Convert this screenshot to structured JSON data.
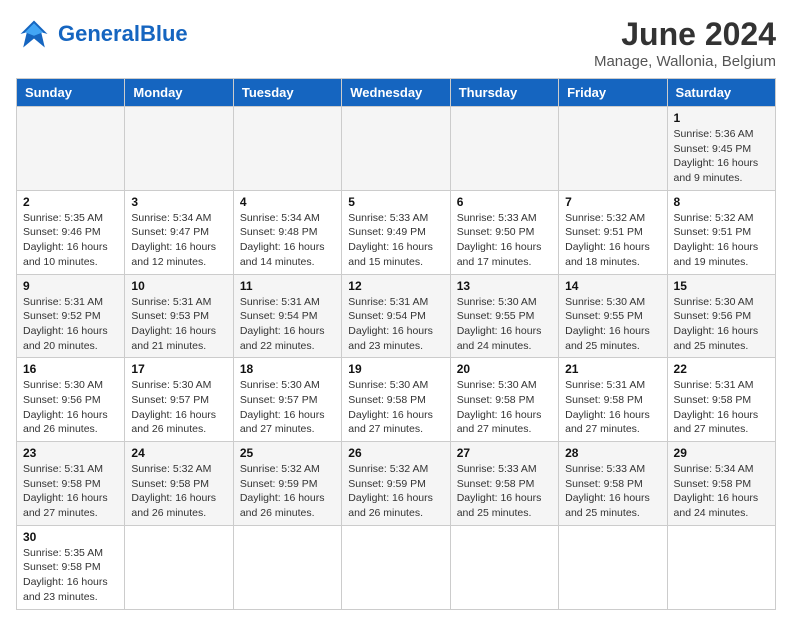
{
  "logo": {
    "text_general": "General",
    "text_blue": "Blue"
  },
  "title": "June 2024",
  "subtitle": "Manage, Wallonia, Belgium",
  "weekdays": [
    "Sunday",
    "Monday",
    "Tuesday",
    "Wednesday",
    "Thursday",
    "Friday",
    "Saturday"
  ],
  "weeks": [
    [
      {
        "day": "",
        "info": ""
      },
      {
        "day": "",
        "info": ""
      },
      {
        "day": "",
        "info": ""
      },
      {
        "day": "",
        "info": ""
      },
      {
        "day": "",
        "info": ""
      },
      {
        "day": "",
        "info": ""
      },
      {
        "day": "1",
        "info": "Sunrise: 5:36 AM\nSunset: 9:45 PM\nDaylight: 16 hours\nand 9 minutes."
      }
    ],
    [
      {
        "day": "2",
        "info": "Sunrise: 5:35 AM\nSunset: 9:46 PM\nDaylight: 16 hours\nand 10 minutes."
      },
      {
        "day": "3",
        "info": "Sunrise: 5:34 AM\nSunset: 9:47 PM\nDaylight: 16 hours\nand 12 minutes."
      },
      {
        "day": "4",
        "info": "Sunrise: 5:34 AM\nSunset: 9:48 PM\nDaylight: 16 hours\nand 14 minutes."
      },
      {
        "day": "5",
        "info": "Sunrise: 5:33 AM\nSunset: 9:49 PM\nDaylight: 16 hours\nand 15 minutes."
      },
      {
        "day": "6",
        "info": "Sunrise: 5:33 AM\nSunset: 9:50 PM\nDaylight: 16 hours\nand 17 minutes."
      },
      {
        "day": "7",
        "info": "Sunrise: 5:32 AM\nSunset: 9:51 PM\nDaylight: 16 hours\nand 18 minutes."
      },
      {
        "day": "8",
        "info": "Sunrise: 5:32 AM\nSunset: 9:51 PM\nDaylight: 16 hours\nand 19 minutes."
      }
    ],
    [
      {
        "day": "9",
        "info": "Sunrise: 5:31 AM\nSunset: 9:52 PM\nDaylight: 16 hours\nand 20 minutes."
      },
      {
        "day": "10",
        "info": "Sunrise: 5:31 AM\nSunset: 9:53 PM\nDaylight: 16 hours\nand 21 minutes."
      },
      {
        "day": "11",
        "info": "Sunrise: 5:31 AM\nSunset: 9:54 PM\nDaylight: 16 hours\nand 22 minutes."
      },
      {
        "day": "12",
        "info": "Sunrise: 5:31 AM\nSunset: 9:54 PM\nDaylight: 16 hours\nand 23 minutes."
      },
      {
        "day": "13",
        "info": "Sunrise: 5:30 AM\nSunset: 9:55 PM\nDaylight: 16 hours\nand 24 minutes."
      },
      {
        "day": "14",
        "info": "Sunrise: 5:30 AM\nSunset: 9:55 PM\nDaylight: 16 hours\nand 25 minutes."
      },
      {
        "day": "15",
        "info": "Sunrise: 5:30 AM\nSunset: 9:56 PM\nDaylight: 16 hours\nand 25 minutes."
      }
    ],
    [
      {
        "day": "16",
        "info": "Sunrise: 5:30 AM\nSunset: 9:56 PM\nDaylight: 16 hours\nand 26 minutes."
      },
      {
        "day": "17",
        "info": "Sunrise: 5:30 AM\nSunset: 9:57 PM\nDaylight: 16 hours\nand 26 minutes."
      },
      {
        "day": "18",
        "info": "Sunrise: 5:30 AM\nSunset: 9:57 PM\nDaylight: 16 hours\nand 27 minutes."
      },
      {
        "day": "19",
        "info": "Sunrise: 5:30 AM\nSunset: 9:58 PM\nDaylight: 16 hours\nand 27 minutes."
      },
      {
        "day": "20",
        "info": "Sunrise: 5:30 AM\nSunset: 9:58 PM\nDaylight: 16 hours\nand 27 minutes."
      },
      {
        "day": "21",
        "info": "Sunrise: 5:31 AM\nSunset: 9:58 PM\nDaylight: 16 hours\nand 27 minutes."
      },
      {
        "day": "22",
        "info": "Sunrise: 5:31 AM\nSunset: 9:58 PM\nDaylight: 16 hours\nand 27 minutes."
      }
    ],
    [
      {
        "day": "23",
        "info": "Sunrise: 5:31 AM\nSunset: 9:58 PM\nDaylight: 16 hours\nand 27 minutes."
      },
      {
        "day": "24",
        "info": "Sunrise: 5:32 AM\nSunset: 9:58 PM\nDaylight: 16 hours\nand 26 minutes."
      },
      {
        "day": "25",
        "info": "Sunrise: 5:32 AM\nSunset: 9:59 PM\nDaylight: 16 hours\nand 26 minutes."
      },
      {
        "day": "26",
        "info": "Sunrise: 5:32 AM\nSunset: 9:59 PM\nDaylight: 16 hours\nand 26 minutes."
      },
      {
        "day": "27",
        "info": "Sunrise: 5:33 AM\nSunset: 9:58 PM\nDaylight: 16 hours\nand 25 minutes."
      },
      {
        "day": "28",
        "info": "Sunrise: 5:33 AM\nSunset: 9:58 PM\nDaylight: 16 hours\nand 25 minutes."
      },
      {
        "day": "29",
        "info": "Sunrise: 5:34 AM\nSunset: 9:58 PM\nDaylight: 16 hours\nand 24 minutes."
      }
    ],
    [
      {
        "day": "30",
        "info": "Sunrise: 5:35 AM\nSunset: 9:58 PM\nDaylight: 16 hours\nand 23 minutes."
      },
      {
        "day": "",
        "info": ""
      },
      {
        "day": "",
        "info": ""
      },
      {
        "day": "",
        "info": ""
      },
      {
        "day": "",
        "info": ""
      },
      {
        "day": "",
        "info": ""
      },
      {
        "day": "",
        "info": ""
      }
    ]
  ]
}
